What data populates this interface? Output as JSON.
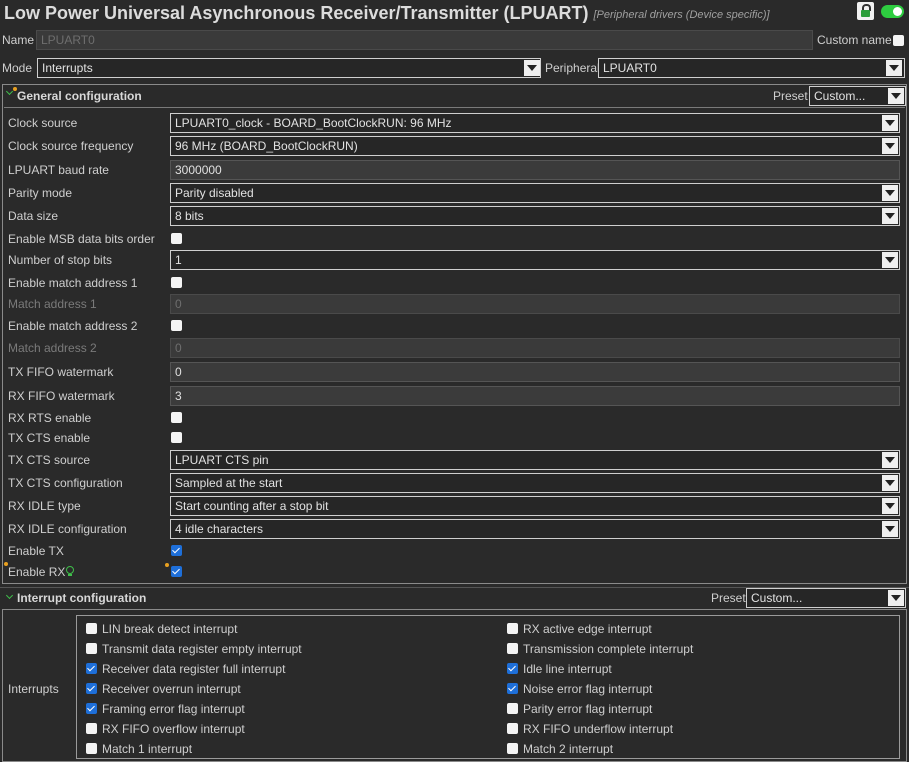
{
  "header": {
    "title": "Low Power Universal Asynchronous Receiver/Transmitter (LPUART)",
    "subtitle": "[Peripheral drivers (Device specific)]",
    "lock_icon": "lock-open-icon",
    "toggle_icon": "toggle-on-icon"
  },
  "name_row": {
    "label": "Name",
    "value": "LPUART0",
    "custom_name_label": "Custom name",
    "custom_name_checked": false
  },
  "mode_row": {
    "label": "Mode",
    "value": "Interrupts",
    "peripheral_label": "Peripheral",
    "peripheral_value": "LPUART0"
  },
  "general": {
    "title": "General configuration",
    "preset_label": "Preset",
    "preset_value": "Custom...",
    "rows": {
      "clock_source": {
        "label": "Clock source",
        "value": "LPUART0_clock - BOARD_BootClockRUN: 96 MHz"
      },
      "clock_freq": {
        "label": "Clock source frequency",
        "value": "96 MHz (BOARD_BootClockRUN)"
      },
      "baud_rate": {
        "label": "LPUART baud rate",
        "value": "3000000"
      },
      "parity": {
        "label": "Parity mode",
        "value": "Parity disabled"
      },
      "data_size": {
        "label": "Data size",
        "value": "8 bits"
      },
      "msb": {
        "label": "Enable MSB data bits order",
        "checked": false
      },
      "stop_bits": {
        "label": "Number of stop bits",
        "value": "1"
      },
      "match_en1": {
        "label": "Enable match address 1",
        "checked": false
      },
      "match_addr1": {
        "label": "Match address 1",
        "value": "0"
      },
      "match_en2": {
        "label": "Enable match address 2",
        "checked": false
      },
      "match_addr2": {
        "label": "Match address 2",
        "value": "0"
      },
      "tx_fifo": {
        "label": "TX FIFO watermark",
        "value": "0"
      },
      "rx_fifo": {
        "label": "RX FIFO watermark",
        "value": "3"
      },
      "rx_rts": {
        "label": "RX RTS enable",
        "checked": false
      },
      "tx_cts": {
        "label": "TX CTS enable",
        "checked": false
      },
      "tx_cts_src": {
        "label": "TX CTS source",
        "value": "LPUART CTS pin"
      },
      "tx_cts_cfg": {
        "label": "TX CTS configuration",
        "value": "Sampled at the start"
      },
      "rx_idle_type": {
        "label": "RX IDLE type",
        "value": "Start counting after a stop bit"
      },
      "rx_idle_cfg": {
        "label": "RX IDLE configuration",
        "value": "4 idle characters"
      },
      "enable_tx": {
        "label": "Enable TX",
        "checked": true
      },
      "enable_rx": {
        "label": "Enable RX",
        "checked": true
      }
    }
  },
  "interrupt": {
    "title": "Interrupt configuration",
    "preset_label": "Preset",
    "preset_value": "Custom...",
    "interrupts_label": "Interrupts",
    "items": [
      {
        "label": "LIN break detect interrupt",
        "checked": false
      },
      {
        "label": "RX active edge interrupt",
        "checked": false
      },
      {
        "label": "Transmit data register empty interrupt",
        "checked": false
      },
      {
        "label": "Transmission complete interrupt",
        "checked": false
      },
      {
        "label": "Receiver data register full interrupt",
        "checked": true
      },
      {
        "label": "Idle line interrupt",
        "checked": true
      },
      {
        "label": "Receiver overrun interrupt",
        "checked": true
      },
      {
        "label": "Noise error flag interrupt",
        "checked": true
      },
      {
        "label": "Framing error flag interrupt",
        "checked": true
      },
      {
        "label": "Parity error flag interrupt",
        "checked": false
      },
      {
        "label": "RX FIFO overflow interrupt",
        "checked": false
      },
      {
        "label": "RX FIFO underflow interrupt",
        "checked": false
      },
      {
        "label": "Match 1 interrupt",
        "checked": false
      },
      {
        "label": "Match 2 interrupt",
        "checked": false
      }
    ]
  },
  "colors": {
    "background": "#2a2a2a",
    "checkbox_checked": "#1e6fd9",
    "toggle_on": "#2ecc40",
    "accent_green": "#3fbf4a",
    "warning": "#e8a020"
  }
}
